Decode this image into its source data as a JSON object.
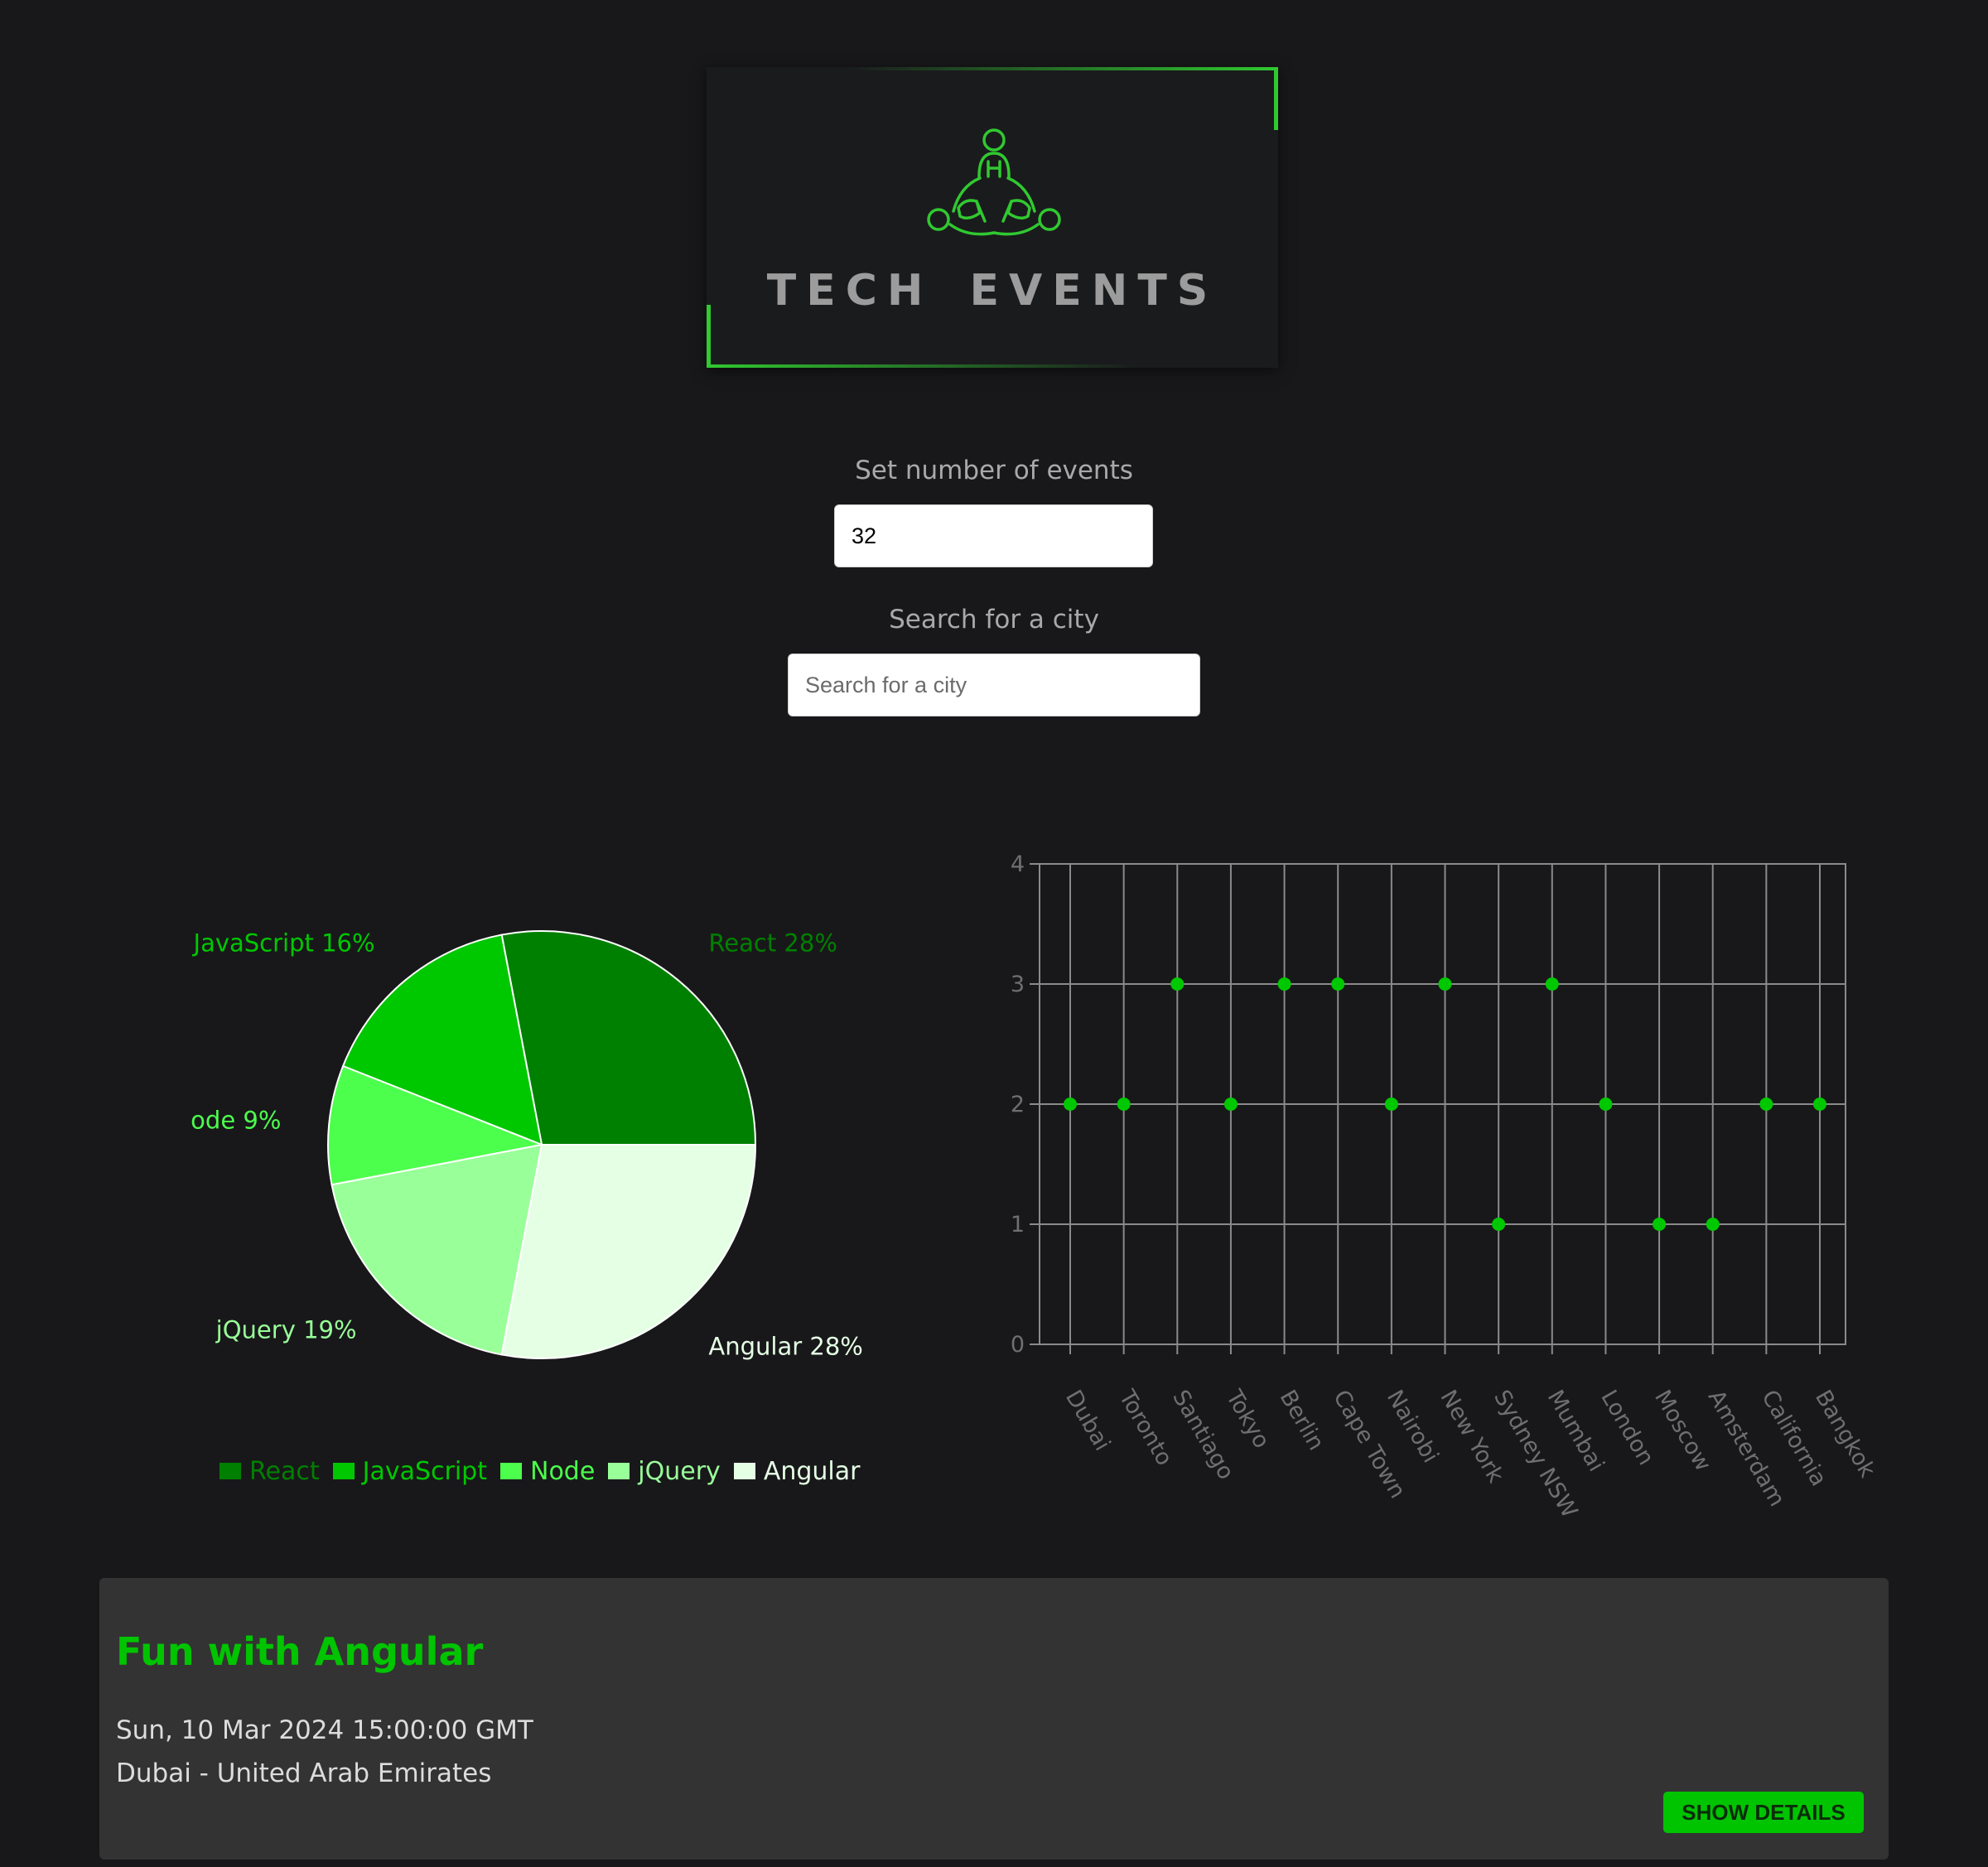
{
  "header": {
    "title": "TECH EVENTS",
    "accent_color": "#30c930",
    "logo_icon": "people-circle-logo-icon"
  },
  "controls": {
    "number_label": "Set number of events",
    "number_value": "32",
    "city_label": "Search for a city",
    "city_placeholder": "Search for a city"
  },
  "chart_data": [
    {
      "type": "pie",
      "slices": [
        {
          "label": "React",
          "percent": 28,
          "color": "#008000"
        },
        {
          "label": "JavaScript",
          "percent": 16,
          "color": "#00c800"
        },
        {
          "label": "Node",
          "percent": 9,
          "color": "#4cff4c"
        },
        {
          "label": "jQuery",
          "percent": 19,
          "color": "#99ff99"
        },
        {
          "label": "Angular",
          "percent": 28,
          "color": "#e5ffe5"
        }
      ],
      "legend": "bottom"
    },
    {
      "type": "scatter",
      "categories": [
        "Dubai",
        "Toronto",
        "Santiago",
        "Tokyo",
        "Berlin",
        "Cape Town",
        "Nairobi",
        "New York",
        "Sydney NSW",
        "Mumbai",
        "London",
        "Moscow",
        "Amsterdam",
        "California",
        "Bangkok"
      ],
      "values": [
        2,
        2,
        3,
        2,
        3,
        3,
        2,
        3,
        1,
        3,
        2,
        1,
        1,
        2,
        2
      ],
      "ylim": [
        0,
        4
      ],
      "yticks": [
        "0",
        "1",
        "2",
        "3",
        "4"
      ],
      "grid": true,
      "point_color": "#00c800",
      "xlabel": "",
      "ylabel": ""
    }
  ],
  "event": {
    "title": "Fun with Angular",
    "date": "Sun, 10 Mar 2024 15:00:00 GMT",
    "location": "Dubai - United Arab Emirates",
    "button_label": "SHOW DETAILS"
  }
}
